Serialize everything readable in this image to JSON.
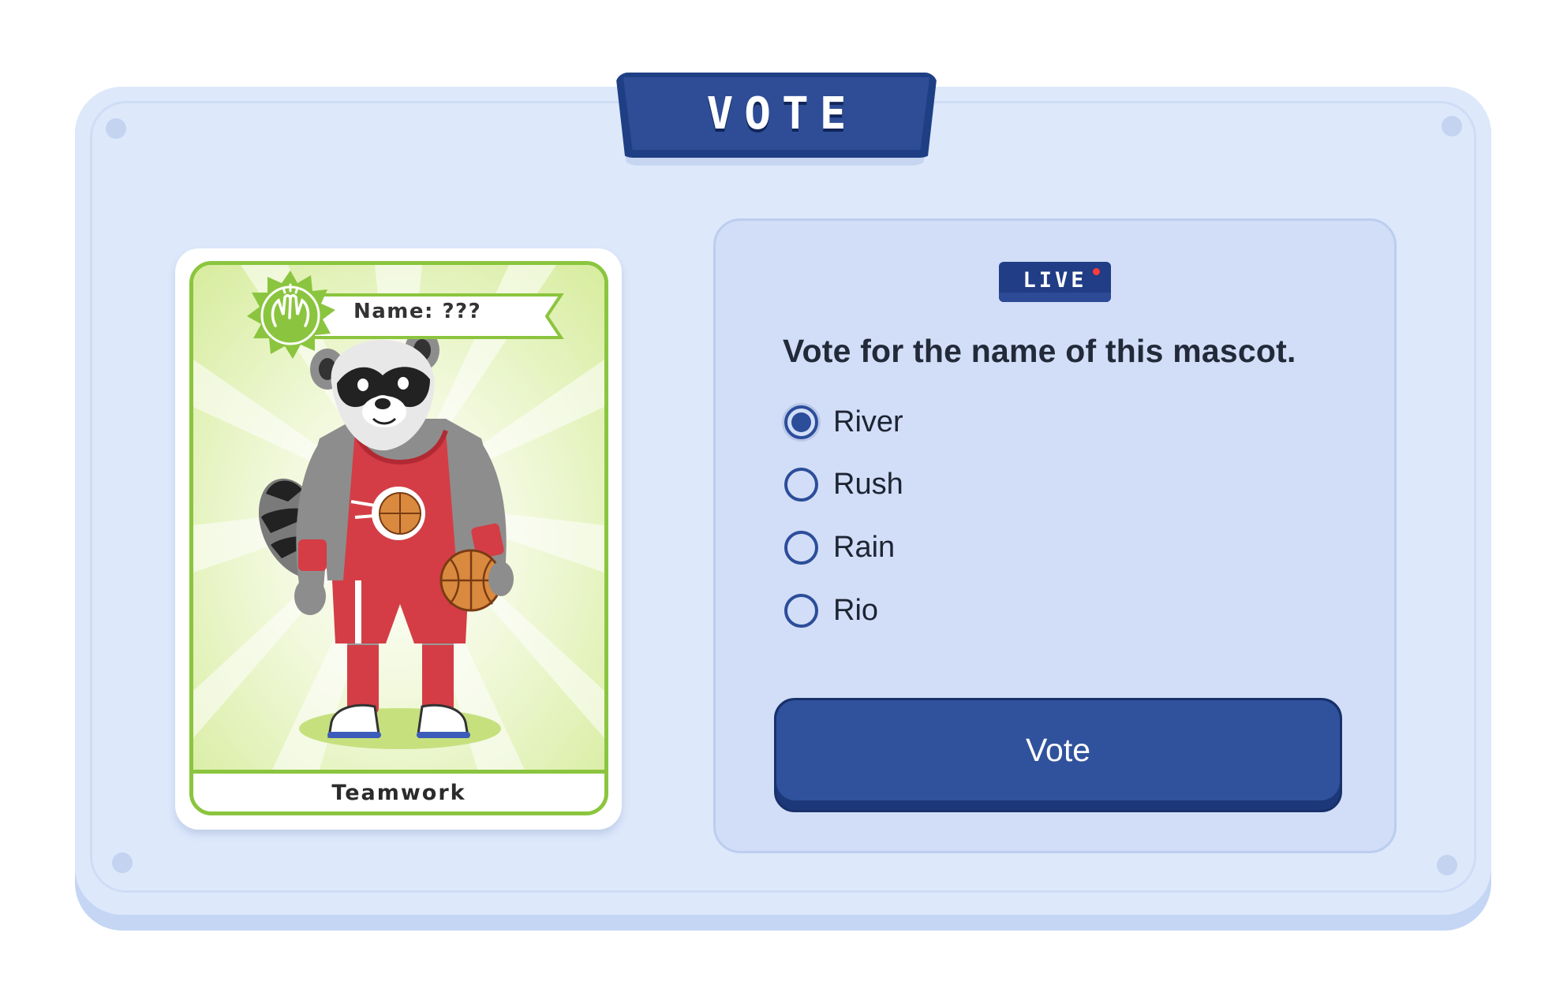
{
  "header": {
    "title": "VOTE"
  },
  "card": {
    "name_label": "Name: ???",
    "trait": "Teamwork",
    "badge_icon": "high-five-icon",
    "mascot": "raccoon-basketball-player"
  },
  "poll": {
    "live_label": "LIVE",
    "question": "Vote for the name of this mascot.",
    "options": [
      {
        "label": "River",
        "selected": true
      },
      {
        "label": "Rush",
        "selected": false
      },
      {
        "label": "Rain",
        "selected": false
      },
      {
        "label": "Rio",
        "selected": false
      }
    ],
    "submit_label": "Vote"
  },
  "colors": {
    "board": "#dde8fb",
    "panel": "#d2def7",
    "accent": "#30529d",
    "card_border": "#8bc53f",
    "live_dot": "#ff3b3b"
  }
}
